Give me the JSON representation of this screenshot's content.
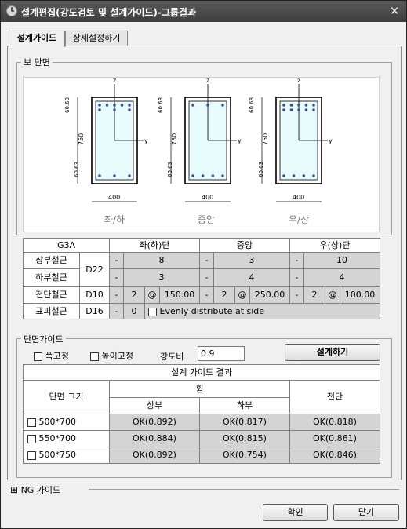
{
  "window": {
    "title": "설계편집(강도검토 및 설계가이드)-그룹결과",
    "close_glyph": "✕"
  },
  "tabs": [
    {
      "label": "설계가이드"
    },
    {
      "label": "상세설정하기"
    }
  ],
  "section_group": {
    "title": "보 단면",
    "sections": [
      {
        "name": "좌/하",
        "width": "400",
        "height": "750",
        "cover_top": "60.63",
        "cover_bottom": "60.63",
        "axis_y": "y",
        "axis_z": "z"
      },
      {
        "name": "중앙",
        "width": "400",
        "height": "750",
        "cover_top": "60.63",
        "cover_bottom": "60.63",
        "axis_y": "y",
        "axis_z": "z"
      },
      {
        "name": "우/상",
        "width": "400",
        "height": "750",
        "cover_top": "60.63",
        "cover_bottom": "60.63",
        "axis_y": "y",
        "axis_z": "z"
      }
    ]
  },
  "rebar_table": {
    "name": "G3A",
    "headers": {
      "left": "좌(하)단",
      "mid": "중앙",
      "right": "우(상)단"
    },
    "top": {
      "label": "상부철근",
      "left": "8",
      "mid": "3",
      "right": "10"
    },
    "bottom": {
      "label": "하부철근",
      "left": "3",
      "mid": "4",
      "right": "4"
    },
    "main_dia": "D22",
    "dash": "-",
    "at": "@",
    "stirrup": {
      "label": "전단철근",
      "dia": "D10",
      "left_n": "2",
      "left_s": "150.00",
      "mid_n": "2",
      "mid_s": "250.00",
      "right_n": "2",
      "right_s": "100.00"
    },
    "skin": {
      "label": "표피철근",
      "dia": "D16",
      "n": "0",
      "option": "Evenly distribute at side"
    }
  },
  "guide": {
    "title": "단면가이드",
    "fix_width": "폭고정",
    "fix_height": "높이고정",
    "strength_label": "강도비",
    "strength_value": "0.9",
    "design_button": "설계하기",
    "result_title": "설계 가이드 결과",
    "col_size": "단면 크기",
    "col_bending": "휨",
    "col_top": "상부",
    "col_bottom": "하부",
    "col_shear": "전단",
    "rows": [
      {
        "size": "500*700",
        "top": "OK(0.892)",
        "bottom": "OK(0.817)",
        "shear": "OK(0.818)"
      },
      {
        "size": "550*700",
        "top": "OK(0.884)",
        "bottom": "OK(0.815)",
        "shear": "OK(0.861)"
      },
      {
        "size": "500*750",
        "top": "OK(0.892)",
        "bottom": "OK(0.754)",
        "shear": "OK(0.846)"
      }
    ]
  },
  "ng_guide": {
    "expander": "⊞",
    "label": "NG 가이드"
  },
  "buttons": {
    "ok": "확인",
    "close": "닫기"
  }
}
